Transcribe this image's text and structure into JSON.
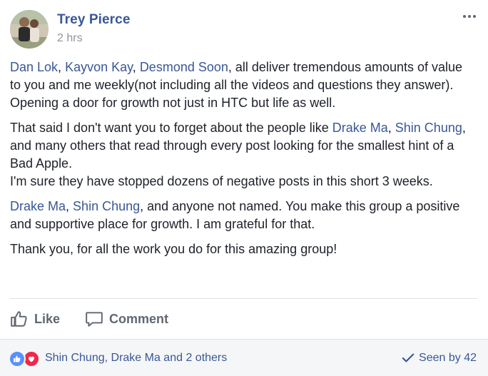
{
  "post": {
    "author": "Trey Pierce",
    "time": "2 hrs",
    "paragraphs": {
      "p1": {
        "m1": "Dan Lok",
        "s1": ", ",
        "m2": "Kayvon Kay",
        "s2": ", ",
        "m3": "Desmond Soon",
        "t1": ", all deliver tremendous amounts of value to you and me weekly(not including all the videos and questions they answer). Opening a door for growth not just in HTC but life as well."
      },
      "p2": {
        "t1": "That said I don't want you to forget about the people like ",
        "m1": "Drake Ma",
        "s1": ", ",
        "m2": "Shin Chung",
        "t2": ", and many others that read through every post looking for the smallest hint of a Bad Apple.",
        "t3": "I'm sure they have stopped dozens of negative posts in this short 3 weeks."
      },
      "p3": {
        "m1": "Drake Ma",
        "s1": ", ",
        "m2": "Shin Chung",
        "t1": ", and anyone not named. You make this group a positive and supportive place for growth. I am grateful for that."
      },
      "p4": {
        "t1": "Thank you, for all the work you do for this amazing group!"
      }
    }
  },
  "actions": {
    "like_label": "Like",
    "comment_label": "Comment"
  },
  "footer": {
    "reactors": "Shin Chung, Drake Ma and 2 others",
    "seen_by": "Seen by 42"
  },
  "icons": {
    "more": "more-dots-icon",
    "like": "thumbs-up-icon",
    "comment": "speech-bubble-icon",
    "reaction_like": "like-reaction-icon",
    "reaction_love": "love-reaction-icon",
    "seen": "checkmark-icon"
  },
  "colors": {
    "link": "#385898",
    "text": "#1d2129",
    "muted": "#90949c",
    "action": "#606770",
    "like_reaction": "#5890ff",
    "love_reaction": "#f0284a",
    "footer_bg": "#f5f6f7"
  }
}
